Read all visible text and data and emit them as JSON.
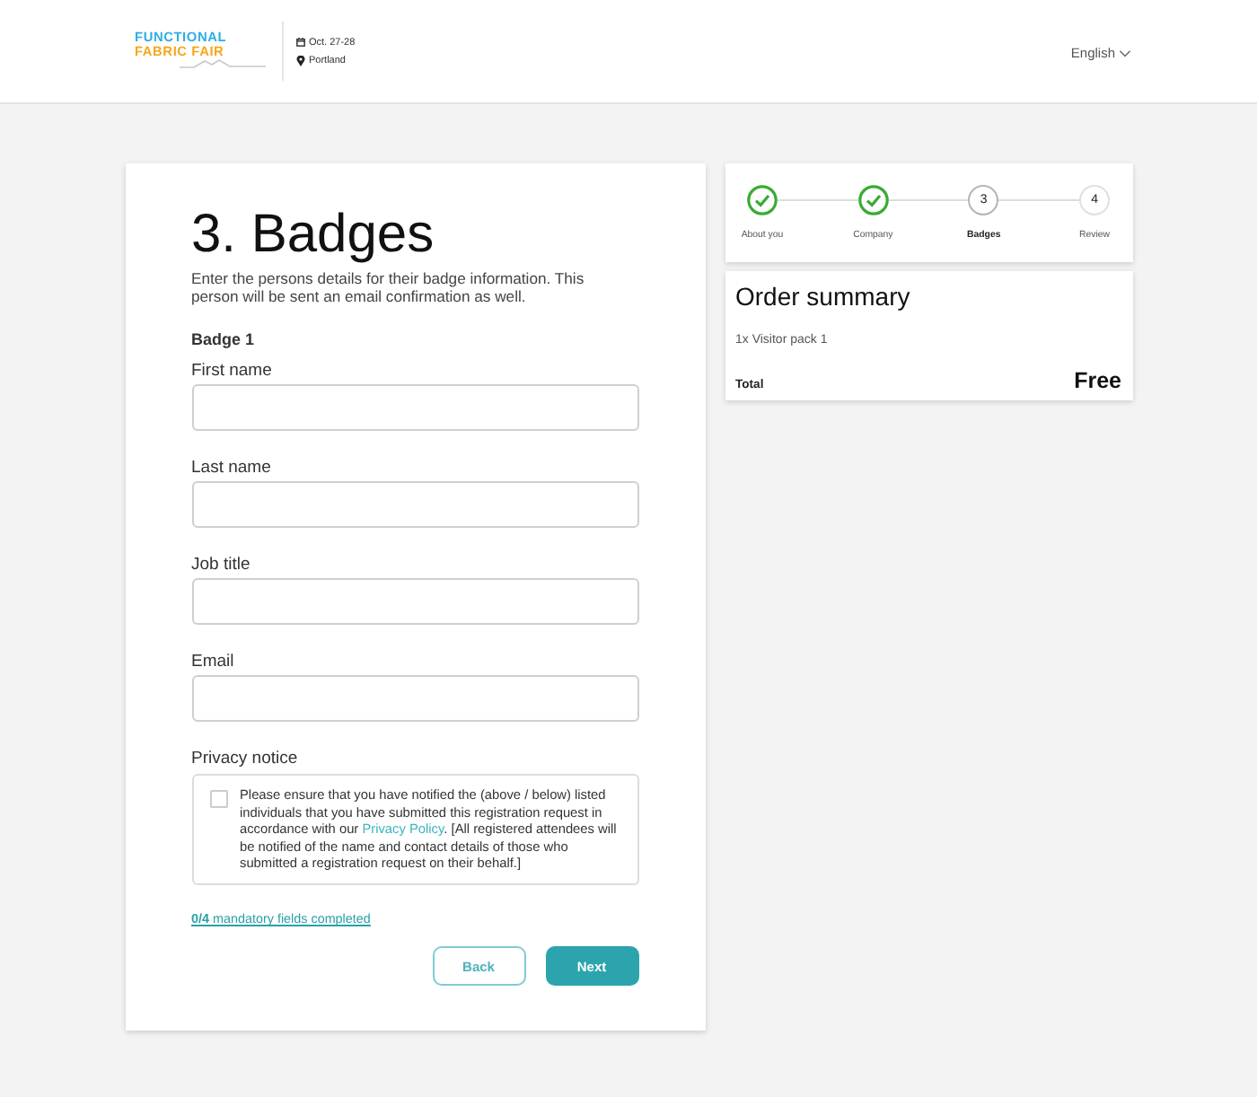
{
  "header": {
    "logo": {
      "line_1": "FUNCTIONAL",
      "line_2": "FABRIC FAIR"
    },
    "event": {
      "date": "Oct. 27-28",
      "location": "Portland"
    },
    "language": "English"
  },
  "form": {
    "title": "3. Badges",
    "description": "Enter the persons details for their badge information. This person will be sent an email confirmation as well.",
    "section": "Badge 1",
    "fields": [
      {
        "label": "First name"
      },
      {
        "label": "Last name"
      },
      {
        "label": "Job title"
      },
      {
        "label": "Email"
      }
    ],
    "privacy": {
      "heading": "Privacy notice",
      "checked": false,
      "text_before": "Please ensure that you have notified the (above / below) listed individuals that you have submitted this registration request in accordance with our ",
      "link": "Privacy Policy",
      "text_after": ". [All registered attendees will be notified of the name and contact details of those who submitted a registration request on their behalf.]"
    },
    "progress": "**0/4** mandatory fields completed",
    "buttons": [
      {
        "label": "Back",
        "kind": "secondary"
      },
      {
        "label": "Next",
        "kind": "primary"
      }
    ]
  },
  "steps": [
    {
      "label": "About you",
      "done": true,
      "selected": false
    },
    {
      "label": "Company",
      "done": true,
      "selected": false
    },
    {
      "number": "3",
      "label": "Badges",
      "done": false,
      "selected": true
    },
    {
      "number": "4",
      "label": "Review",
      "done": false,
      "selected": false
    }
  ],
  "order_summary": {
    "title": "Order summary",
    "items": [
      "1x Visitor pack 1"
    ],
    "total_label": "Total",
    "total_value": "Free"
  }
}
